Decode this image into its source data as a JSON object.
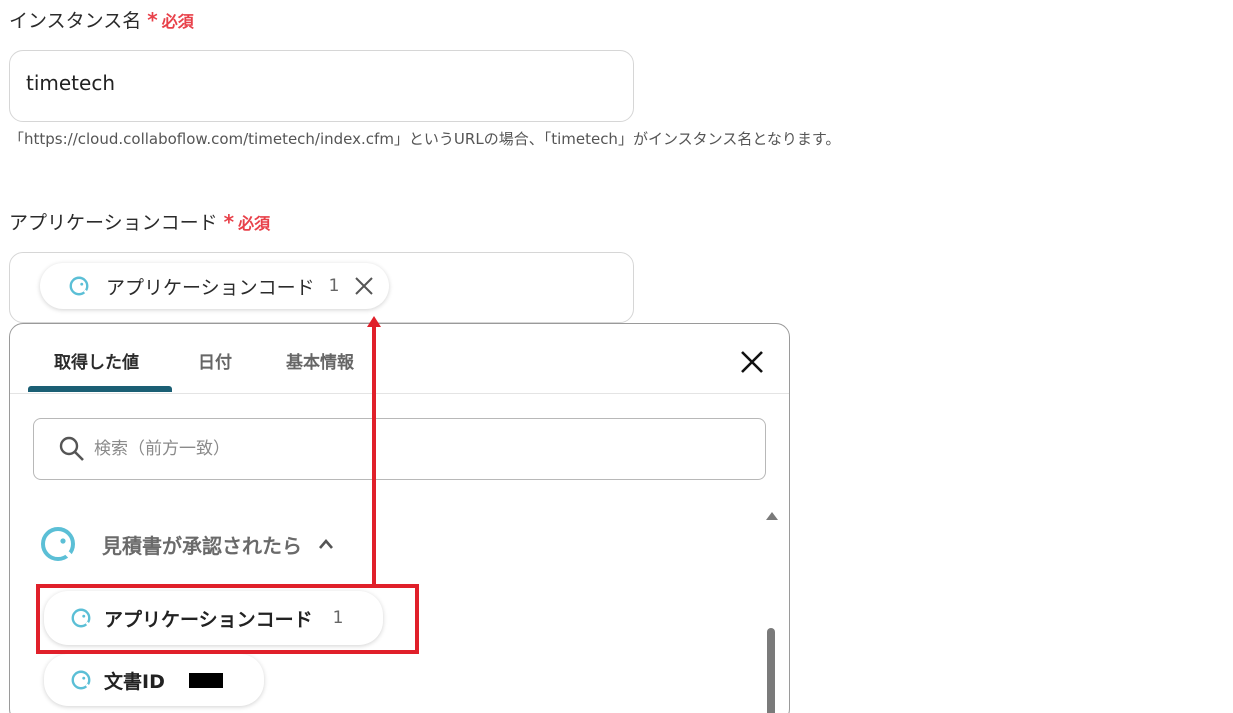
{
  "instance_field": {
    "label": "インスタンス名",
    "required_star": "*",
    "required_text": "必須",
    "value": "timetech",
    "help": "「https://cloud.collaboflow.com/timetech/index.cfm」というURLの場合、「timetech」がインスタンス名となります。"
  },
  "app_code_field": {
    "label": "アプリケーションコード",
    "required_star": "*",
    "required_text": "必須",
    "chip_label": "アプリケーションコード",
    "chip_count": "1"
  },
  "picker": {
    "tabs": [
      {
        "label": "取得した値",
        "active": true
      },
      {
        "label": "日付",
        "active": false
      },
      {
        "label": "基本情報",
        "active": false
      }
    ],
    "search_placeholder": "検索（前方一致）",
    "group_label": "見積書が承認されたら",
    "items": [
      {
        "label": "アプリケーションコード",
        "count": "1"
      },
      {
        "label": "文書ID",
        "count": ""
      }
    ]
  },
  "colors": {
    "required": "#e8414a",
    "tab_underline": "#1b5f74",
    "icon_teal": "#5bbfd6",
    "highlight": "#e0202a"
  }
}
